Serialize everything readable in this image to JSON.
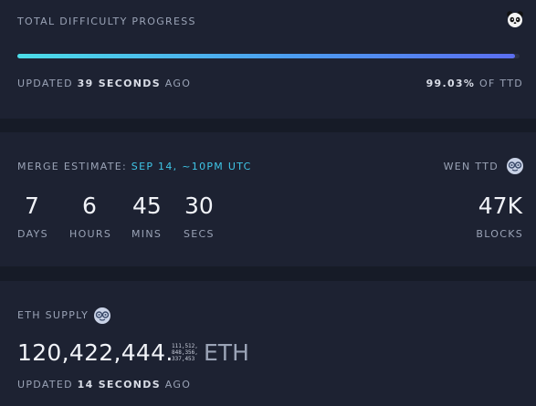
{
  "difficulty": {
    "title": "TOTAL DIFFICULTY PROGRESS",
    "progress_fraction": 0.9903,
    "updated_prefix": "UPDATED",
    "updated_value": "39 SECONDS",
    "updated_suffix": "AGO",
    "percent": "99.03%",
    "percent_suffix": "OF TTD"
  },
  "merge": {
    "label": "MERGE ESTIMATE:",
    "estimate": "SEP 14, ~10PM UTC",
    "countdown": [
      {
        "value": "7",
        "unit": "DAYS"
      },
      {
        "value": "6",
        "unit": "HOURS"
      },
      {
        "value": "45",
        "unit": "MINS"
      },
      {
        "value": "30",
        "unit": "SECS"
      }
    ],
    "wen_label": "WEN TTD",
    "blocks_value": "47K",
    "blocks_unit": "BLOCKS"
  },
  "supply": {
    "label": "ETH SUPPLY",
    "main": "120,422,444.",
    "fraction_lines": [
      "111,512,",
      "848,356,",
      "337,453"
    ],
    "unit": "ETH",
    "updated_prefix": "UPDATED",
    "updated_value": "14 SECONDS",
    "updated_suffix": "AGO"
  },
  "icons": {
    "panda": "panda-icon",
    "nerd": "nerd-face-icon"
  },
  "colors": {
    "background": "#161b27",
    "panel": "#1d2232",
    "accent": "#3fc6e7",
    "bar_start": "#4bdde8",
    "bar_end": "#5b6ef0"
  }
}
